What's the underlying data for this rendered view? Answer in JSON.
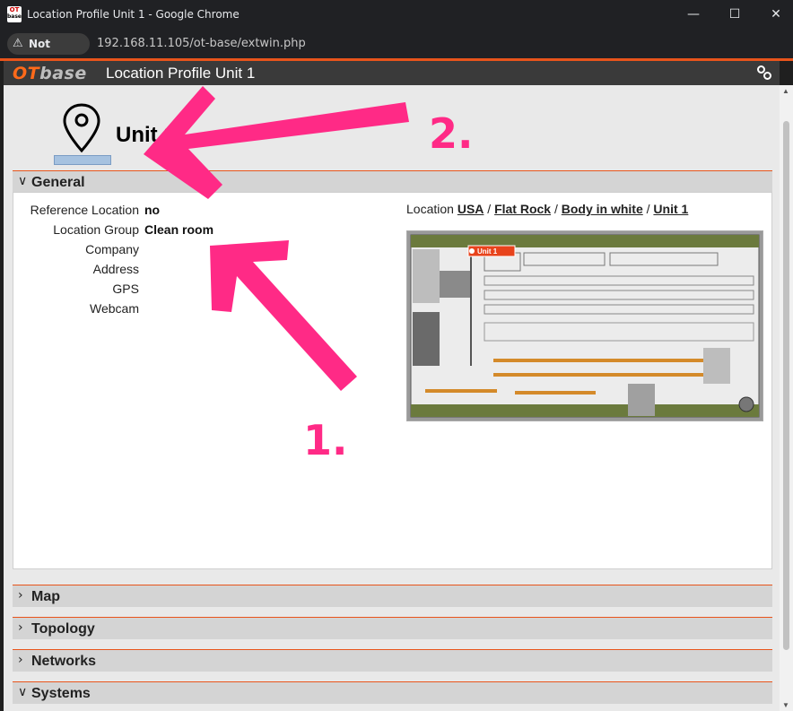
{
  "window": {
    "title": "Location Profile Unit 1 - Google Chrome",
    "favicon_text_top": "OT",
    "favicon_text_bottom": "base"
  },
  "addressbar": {
    "security_label": "Not secure",
    "url": "192.168.11.105/ot-base/extwin.php"
  },
  "app": {
    "logo_ot": "OT",
    "logo_base": "base",
    "title": "Location Profile  Unit 1"
  },
  "heading": {
    "unit_name": "Unit 1"
  },
  "sections": {
    "general": "General",
    "map": "Map",
    "topology": "Topology",
    "networks": "Networks",
    "systems": "Systems"
  },
  "fields": [
    {
      "label": "Reference Location",
      "value": "no"
    },
    {
      "label": "Location Group",
      "value": "Clean room"
    },
    {
      "label": "Company",
      "value": ""
    },
    {
      "label": "Address",
      "value": ""
    },
    {
      "label": "GPS",
      "value": ""
    },
    {
      "label": "Webcam",
      "value": ""
    }
  ],
  "location_path": {
    "prefix": "Location",
    "parts": [
      "USA",
      "Flat Rock",
      "Body in white",
      "Unit 1"
    ],
    "separator": "/"
  },
  "floorplan": {
    "marker_label": "Unit 1"
  },
  "annotations": {
    "arrow1_label": "1.",
    "arrow2_label": "2."
  },
  "colors": {
    "accent": "#e8541b",
    "annotation": "#ff2a86",
    "header_bg": "#3a3a3a"
  }
}
